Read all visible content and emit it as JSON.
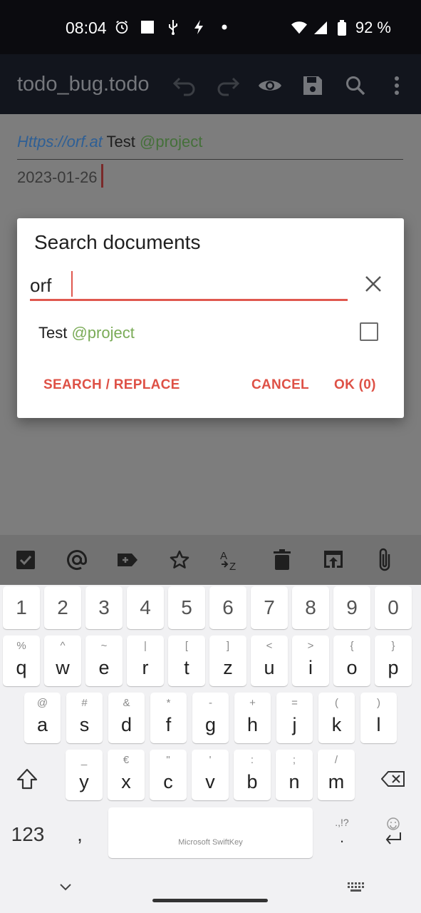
{
  "status_bar": {
    "time": "08:04",
    "battery": "92 %"
  },
  "app_bar": {
    "title": "todo_bug.todo",
    "icons": [
      "undo-icon",
      "redo-icon",
      "eye-icon",
      "save-icon",
      "search-icon",
      "more-vert-icon"
    ]
  },
  "editor": {
    "line1": {
      "link": "Https://orf.at",
      "text": " Test ",
      "project": "@project"
    },
    "line2": "2023-01-26"
  },
  "dialog": {
    "title": "Search documents",
    "search_value": "orf",
    "results": [
      {
        "text": "Test ",
        "project": "@project",
        "checked": false
      }
    ],
    "buttons": {
      "search_replace": "SEARCH / REPLACE",
      "cancel": "CANCEL",
      "ok": "OK (0)"
    }
  },
  "keyboard_toolbar": [
    "checkbox-icon",
    "at-icon",
    "tag-add-icon",
    "star-icon",
    "sort-az-icon",
    "delete-icon",
    "open-in-browser-icon",
    "attachment-icon"
  ],
  "keyboard": {
    "number_row": [
      "1",
      "2",
      "3",
      "4",
      "5",
      "6",
      "7",
      "8",
      "9",
      "0"
    ],
    "row1": {
      "main": [
        "q",
        "w",
        "e",
        "r",
        "t",
        "z",
        "u",
        "i",
        "o",
        "p"
      ],
      "sub": [
        "%",
        "^",
        "~",
        "|",
        "[",
        "]",
        "<",
        ">",
        "{",
        "}"
      ]
    },
    "row2": {
      "main": [
        "a",
        "s",
        "d",
        "f",
        "g",
        "h",
        "j",
        "k",
        "l"
      ],
      "sub": [
        "@",
        "#",
        "&",
        "*",
        "-",
        "+",
        "=",
        "(",
        ")"
      ]
    },
    "row3": {
      "main": [
        "y",
        "x",
        "c",
        "v",
        "b",
        "n",
        "m"
      ],
      "sub": [
        "_",
        "€",
        "\"",
        "'",
        ":",
        ";",
        "/"
      ]
    },
    "bottom": {
      "numbers": "123",
      "comma": ",",
      "space": "Microsoft SwiftKey",
      "punct_top": ".,!?",
      "punct_bottom": "."
    }
  }
}
